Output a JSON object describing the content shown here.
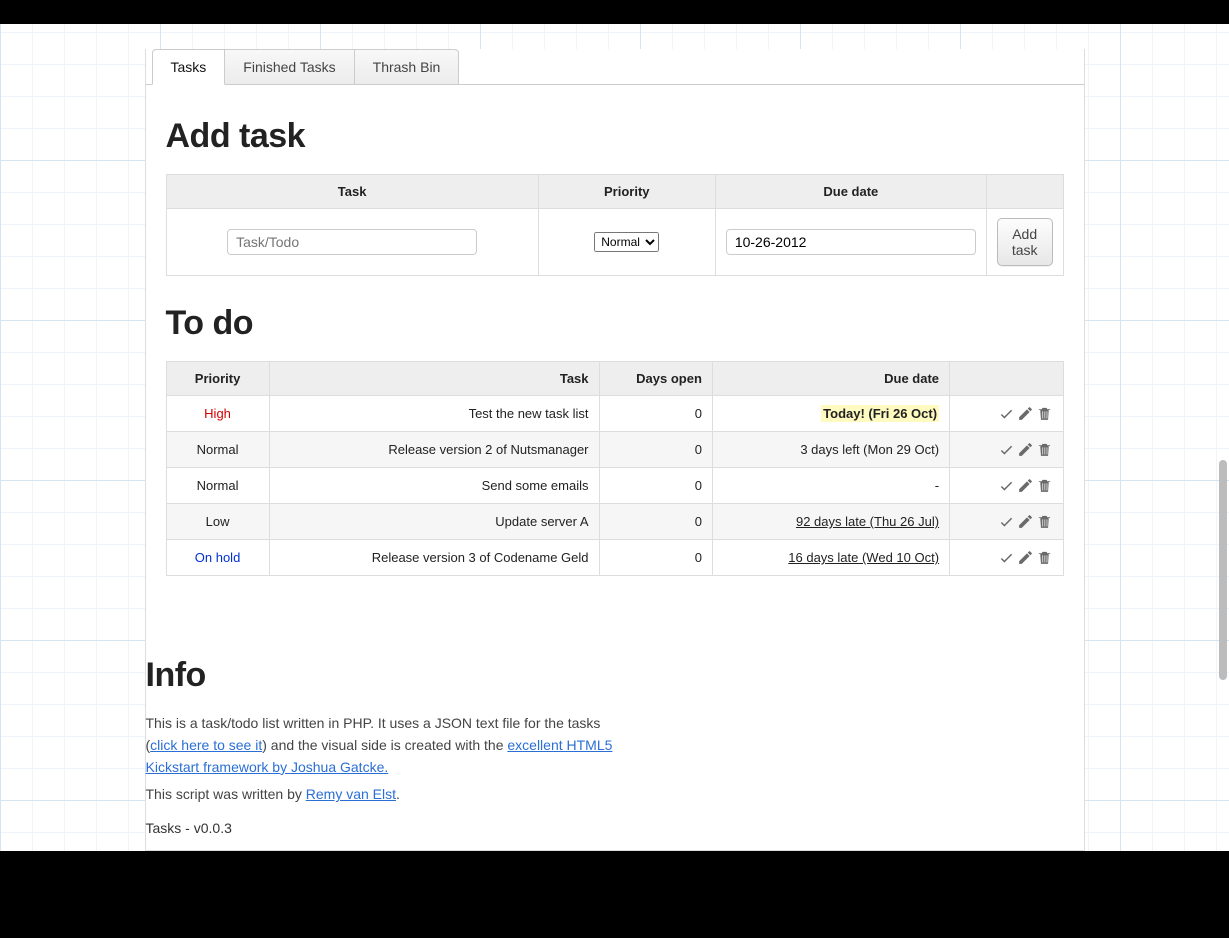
{
  "tabs": [
    {
      "label": "Tasks",
      "active": true
    },
    {
      "label": "Finished Tasks",
      "active": false
    },
    {
      "label": "Thrash Bin",
      "active": false
    }
  ],
  "add": {
    "heading": "Add task",
    "columns": {
      "task": "Task",
      "priority": "Priority",
      "due": "Due date"
    },
    "task_placeholder": "Task/Todo",
    "priority_value": "Normal",
    "due_value": "10-26-2012",
    "button_label": "Add task"
  },
  "todo": {
    "heading": "To do",
    "columns": {
      "priority": "Priority",
      "task": "Task",
      "days_open": "Days open",
      "due": "Due date"
    },
    "rows": [
      {
        "priority": "High",
        "priority_class": "High",
        "task": "Test the new task list",
        "days_open": "0",
        "due": "Today! (Fri 26 Oct)",
        "due_style": "today"
      },
      {
        "priority": "Normal",
        "priority_class": "Normal",
        "task": "Release version 2 of Nutsmanager",
        "days_open": "0",
        "due": "3 days left (Mon 29 Oct)",
        "due_style": "normal"
      },
      {
        "priority": "Normal",
        "priority_class": "Normal",
        "task": "Send some emails",
        "days_open": "0",
        "due": "-",
        "due_style": "normal"
      },
      {
        "priority": "Low",
        "priority_class": "Low",
        "task": "Update server A",
        "days_open": "0",
        "due": "92 days late (Thu 26 Jul)",
        "due_style": "late"
      },
      {
        "priority": "On hold",
        "priority_class": "Onhold",
        "task": "Release version 3 of Codename Geld",
        "days_open": "0",
        "due": "16 days late (Wed 10 Oct)",
        "due_style": "late"
      }
    ]
  },
  "info": {
    "heading": "Info",
    "text1a": "This is a task/todo list written in PHP. It uses a JSON text file for the tasks (",
    "link1": "click here to see it",
    "text1b": ") and the visual side is created with the ",
    "link2": "excellent HTML5 Kickstart framework by Joshua Gatcke.",
    "text2a": "This script was written by ",
    "link3": "Remy van Elst",
    "text2b": ".",
    "version": "Tasks - v0.0.3"
  }
}
